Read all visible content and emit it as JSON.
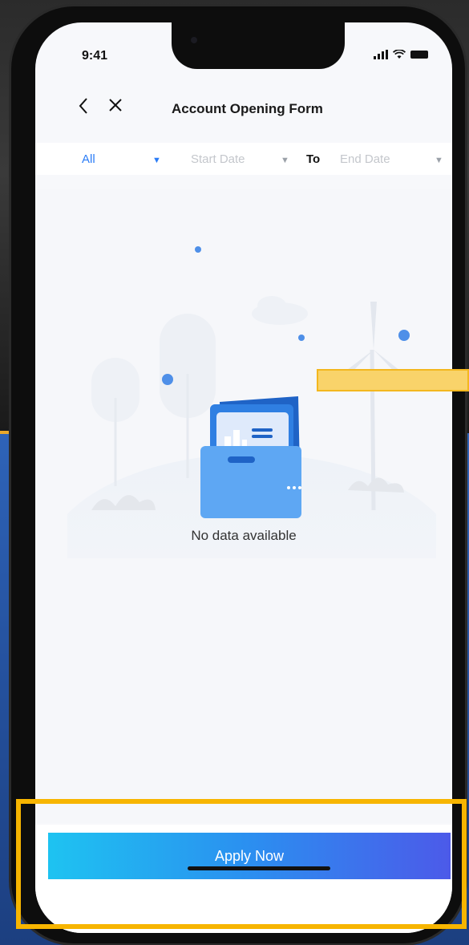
{
  "status_bar": {
    "time": "9:41"
  },
  "nav": {
    "back_icon": "chevron-left-icon",
    "close_icon": "close-icon",
    "title": "Account Opening Form"
  },
  "filter": {
    "category": "All",
    "start_placeholder": "Start Date",
    "to_label": "To",
    "end_placeholder": "End Date"
  },
  "empty_state": {
    "message": "No data available"
  },
  "footer": {
    "apply_label": "Apply Now"
  },
  "colors": {
    "accent": "#2b7cf6",
    "button_gradient_start": "#1ec3f1",
    "button_gradient_end": "#4c5ae9",
    "highlight": "#f7b500"
  }
}
